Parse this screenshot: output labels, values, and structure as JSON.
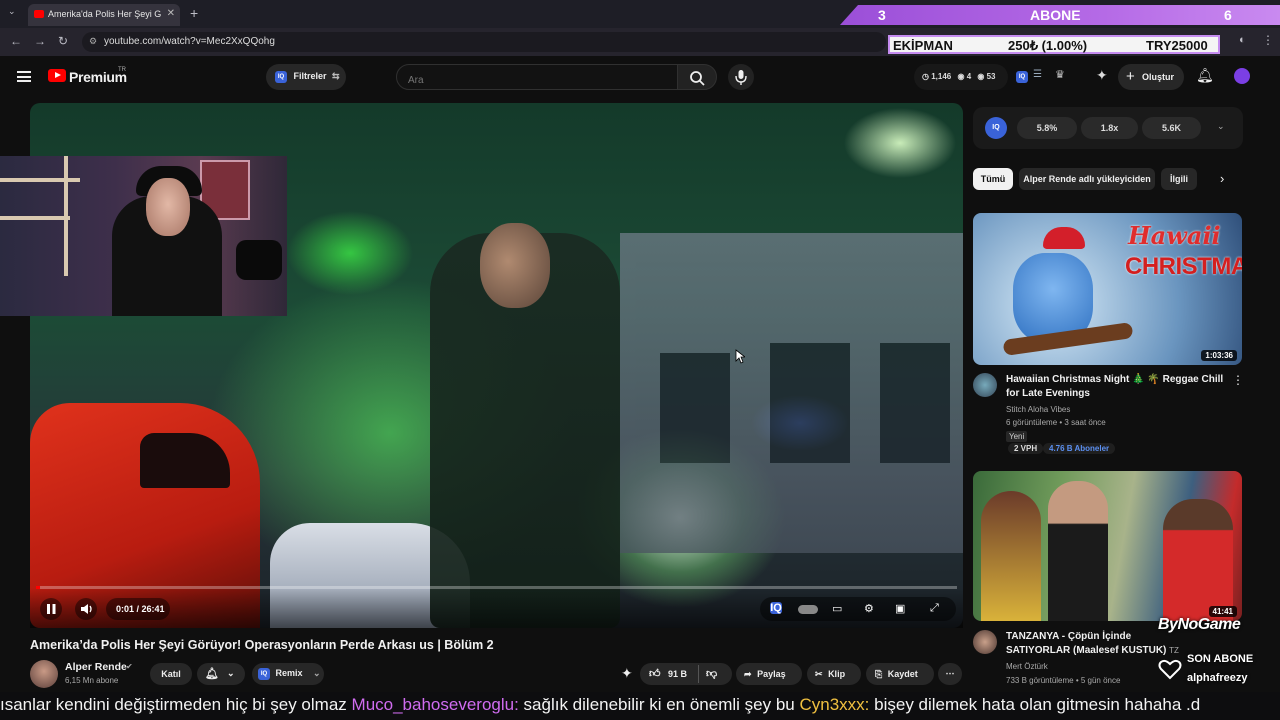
{
  "browser": {
    "tab_title": "Amerika'da Polis Her Şeyi G",
    "url": "youtube.com/watch?v=Mec2XxQQohg"
  },
  "overlay": {
    "banner_count_left": "3",
    "banner_label": "ABONE",
    "banner_count_right": "6",
    "ekipman_label": "EKİPMAN",
    "ekipman_amount": "250₺ (1.00%)",
    "ekipman_goal": "TRY25000",
    "brand": "ByNoGame",
    "last_sub_label": "SON ABONE",
    "last_sub_user": "alphafreezy"
  },
  "header": {
    "logo_text": "Premium",
    "logo_region": "TR",
    "filters_label": "Filtreler",
    "search_placeholder": "Ara",
    "stat_views": "1,146",
    "stat_a": "4",
    "stat_b": "53",
    "create_label": "Oluştur"
  },
  "player": {
    "time": "0:01 / 26:41",
    "progress": 0.001
  },
  "video": {
    "title": "Amerika’da Polis Her Şeyi Görüyor! Operasyonların Perde Arkası us | Bölüm 2",
    "channel": "Alper Rende",
    "subscribers": "6,15 Mn abone",
    "join_label": "Katıl",
    "remix_label": "Remix",
    "likes": "91 B",
    "share_label": "Paylaş",
    "clip_label": "Klip",
    "save_label": "Kaydet"
  },
  "sidebar": {
    "iq_stats": [
      "5.8%",
      "1.8x",
      "5.6K"
    ],
    "chips": [
      "Tümü",
      "Alper Rende adlı yükleyiciden",
      "İlgili"
    ],
    "videos": [
      {
        "thumb_text_1": "Hawaii",
        "thumb_text_2": "CHRISTMAS",
        "duration": "1:03:36",
        "title": "Hawaiian Christmas Night 🎄 🌴 Reggae Chill for Late Evenings",
        "channel": "Stitch Aloha Vibes",
        "meta": "6 görüntüleme • 3 saat önce",
        "badge": "Yeni",
        "vph": "2 VPH",
        "subs": "4.76 B Aboneler"
      },
      {
        "duration": "41:41",
        "title": "TANZANYA - Çöpün İçinde SATIYORLAR (Maalesef KUSTUK)",
        "title_suffix": "TZ",
        "channel": "Mert Öztürk",
        "meta": "733 B görüntüleme • 5 gün önce"
      }
    ]
  },
  "chat": [
    {
      "user": "",
      "message": "ısanlar kendini değiştirmeden hiç bi şey olmaz"
    },
    {
      "user": "Muco_bahoseveroglu:",
      "message": "sağlık dilenebilir ki en önemli şey bu"
    },
    {
      "user": "Cyn3xxx:",
      "message": "bişey dilemek hata olan gitmesin hahaha .d"
    }
  ],
  "colors": {
    "accent_red": "#ff0000",
    "banner_purple": "#b56ae6",
    "chat_user_purple": "#d06cf0",
    "chat_user_gold": "#f0c040"
  }
}
